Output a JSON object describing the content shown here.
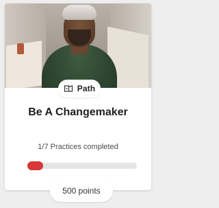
{
  "card": {
    "badge": {
      "label": "Path",
      "icon": "path-puzzle-icon"
    },
    "title": "Be A Changemaker",
    "progress": {
      "text": "1/7 Practices completed",
      "completed": 1,
      "total": 7,
      "fill_color": "#d73737"
    },
    "points": "500 points"
  }
}
